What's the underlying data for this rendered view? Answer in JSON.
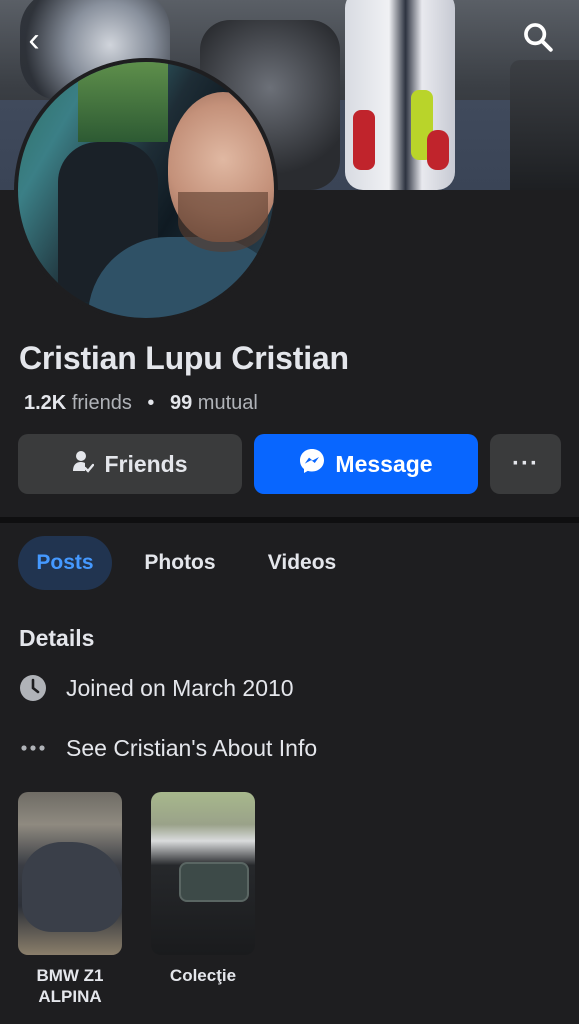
{
  "profile": {
    "name": "Cristian Lupu Cristian",
    "friends_count": "1.2K",
    "friends_label": "friends",
    "mutual_count": "99",
    "mutual_label": "mutual"
  },
  "actions": {
    "friends_label": "Friends",
    "message_label": "Message",
    "more_label": "···"
  },
  "tabs": [
    {
      "label": "Posts",
      "active": true
    },
    {
      "label": "Photos",
      "active": false
    },
    {
      "label": "Videos",
      "active": false
    }
  ],
  "details": {
    "title": "Details",
    "joined": "Joined on March 2010",
    "about": "See Cristian's About Info"
  },
  "featured": [
    {
      "caption": "BMW Z1 ALPINA"
    },
    {
      "caption": "Colecţie"
    }
  ],
  "colors": {
    "background": "#1e1e20",
    "accent": "#0866ff",
    "active_tab_bg": "#213450",
    "active_tab_text": "#4599ff"
  },
  "icons": [
    "back-arrow-icon",
    "search-icon",
    "friends-check-icon",
    "messenger-icon",
    "more-dots-icon",
    "clock-icon",
    "dots-icon"
  ]
}
